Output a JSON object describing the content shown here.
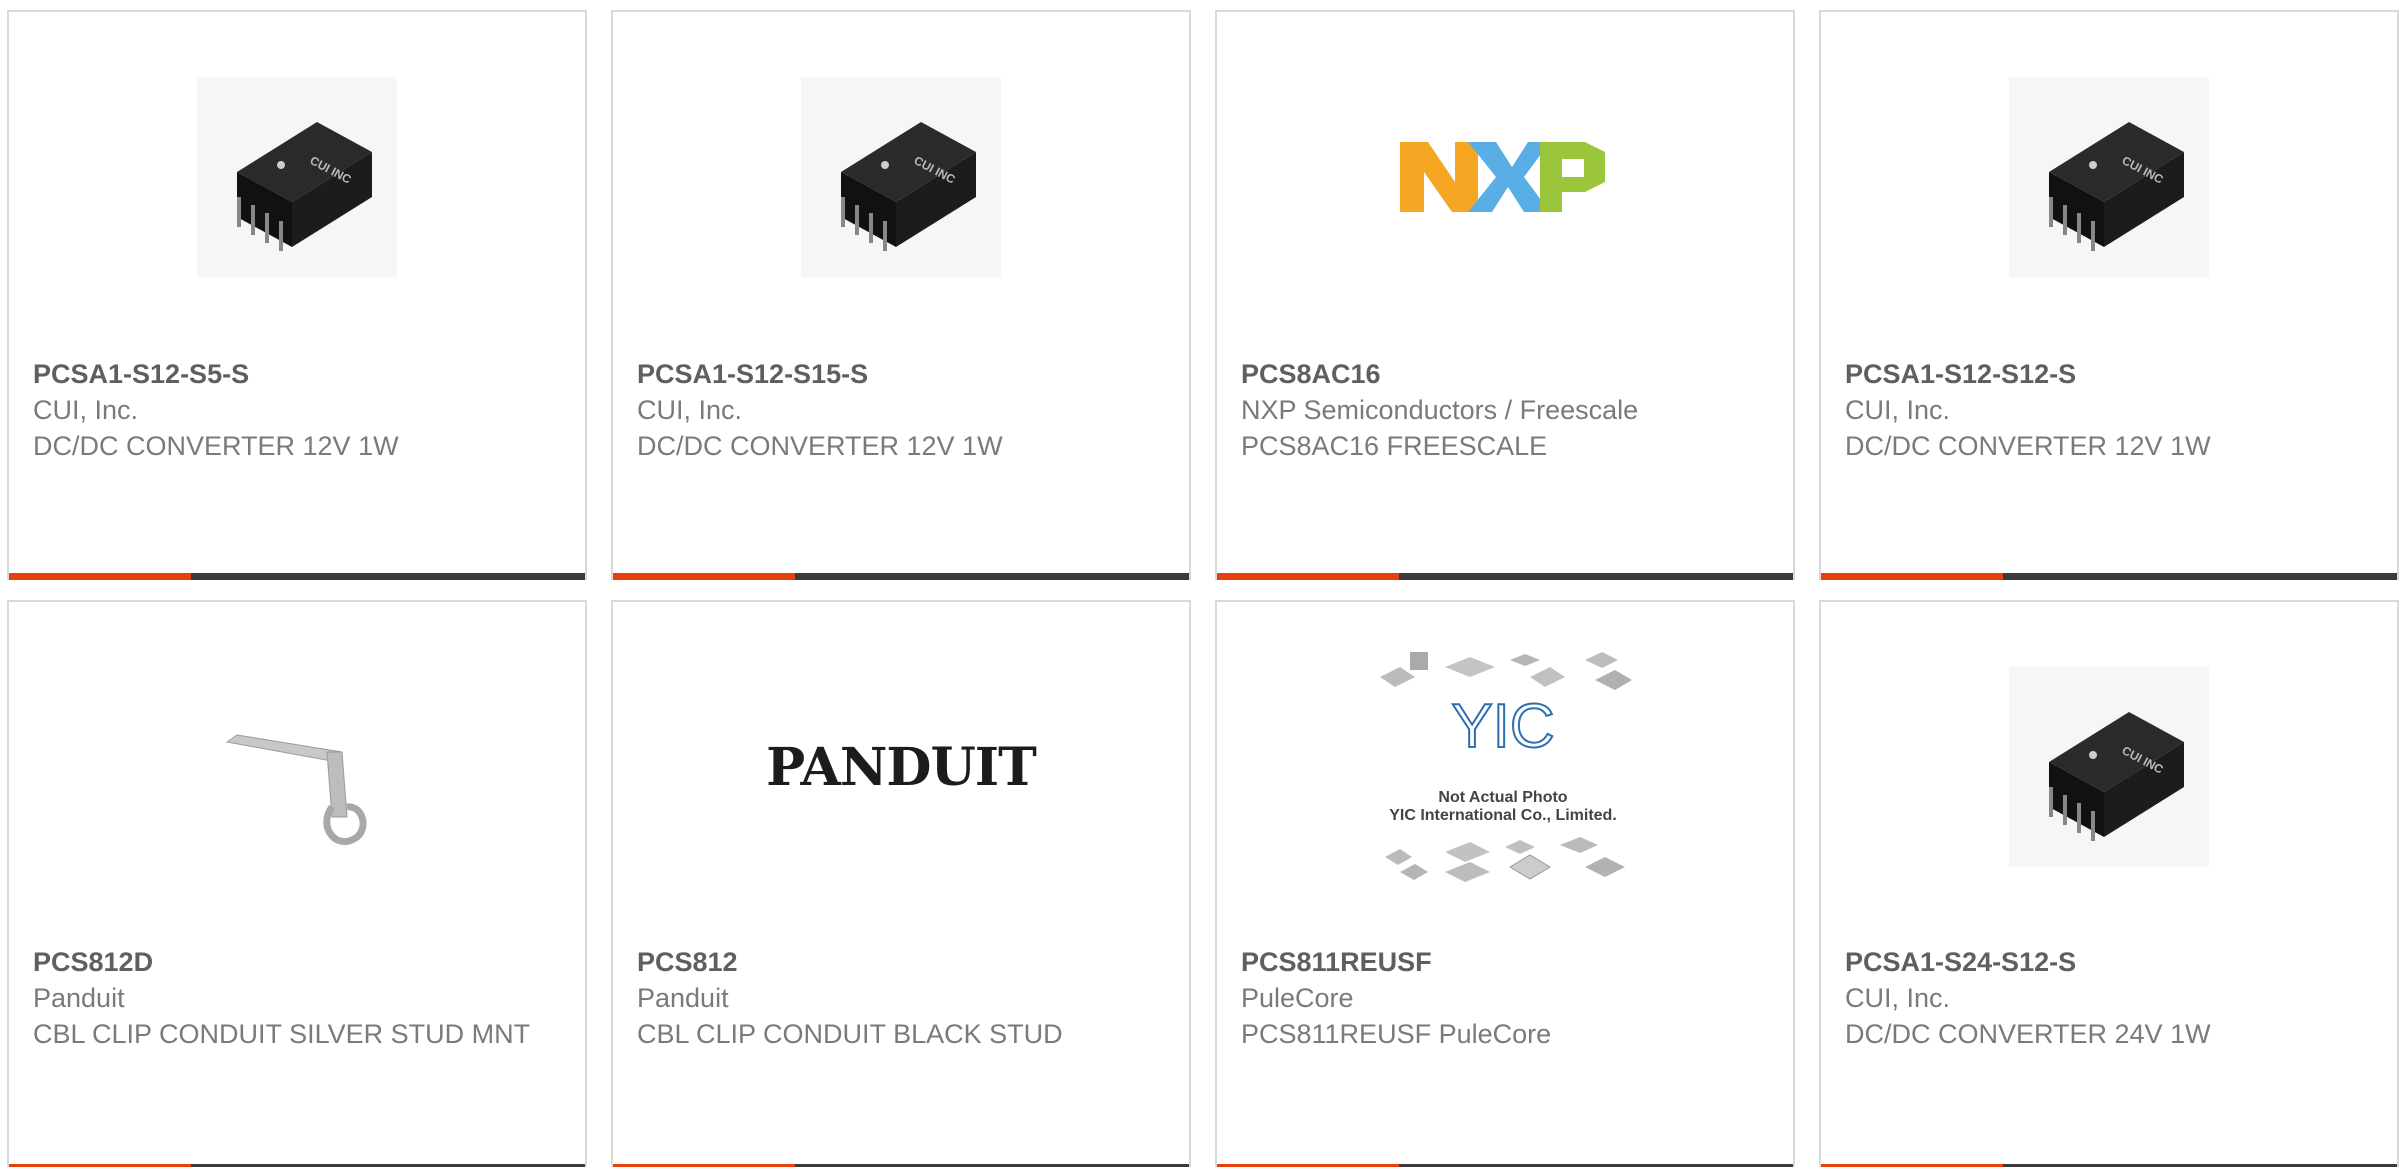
{
  "colors": {
    "accent": "#e8400c",
    "bar": "#3b3b3b",
    "part_text": "#5f5f5f",
    "body_text": "#7a7a7a",
    "border": "#d9d9d9"
  },
  "products": [
    {
      "part": "PCSA1-S12-S5-S",
      "manufacturer": "CUI, Inc.",
      "description": "DC/DC CONVERTER 12V 1W",
      "image": "cui-dc-converter-image"
    },
    {
      "part": "PCSA1-S12-S15-S",
      "manufacturer": "CUI, Inc.",
      "description": "DC/DC CONVERTER 12V 1W",
      "image": "cui-dc-converter-image"
    },
    {
      "part": "PCS8AC16",
      "manufacturer": "NXP Semiconductors / Freescale",
      "description": "PCS8AC16 FREESCALE",
      "image": "nxp-logo"
    },
    {
      "part": "PCSA1-S12-S12-S",
      "manufacturer": "CUI, Inc.",
      "description": "DC/DC CONVERTER 12V 1W",
      "image": "cui-dc-converter-image"
    },
    {
      "part": "PCS812D",
      "manufacturer": "Panduit",
      "description": "CBL CLIP CONDUIT SILVER STUD MNT",
      "image": "conduit-clip-image"
    },
    {
      "part": "PCS812",
      "manufacturer": "Panduit",
      "description": "CBL CLIP CONDUIT BLACK STUD",
      "image": "panduit-logo"
    },
    {
      "part": "PCS811REUSF",
      "manufacturer": "PuleCore",
      "description": "PCS811REUSF PuleCore",
      "image": "yic-placeholder-image",
      "image_text": {
        "logo": "YIC",
        "line1": "Not Actual Photo",
        "line2": "YIC International Co., Limited."
      }
    },
    {
      "part": "PCSA1-S24-S12-S",
      "manufacturer": "CUI, Inc.",
      "description": "DC/DC CONVERTER 24V 1W",
      "image": "cui-dc-converter-image"
    }
  ],
  "logos": {
    "cui": "CUI INC",
    "nxp": "NXP",
    "panduit": "PANDUIT"
  }
}
